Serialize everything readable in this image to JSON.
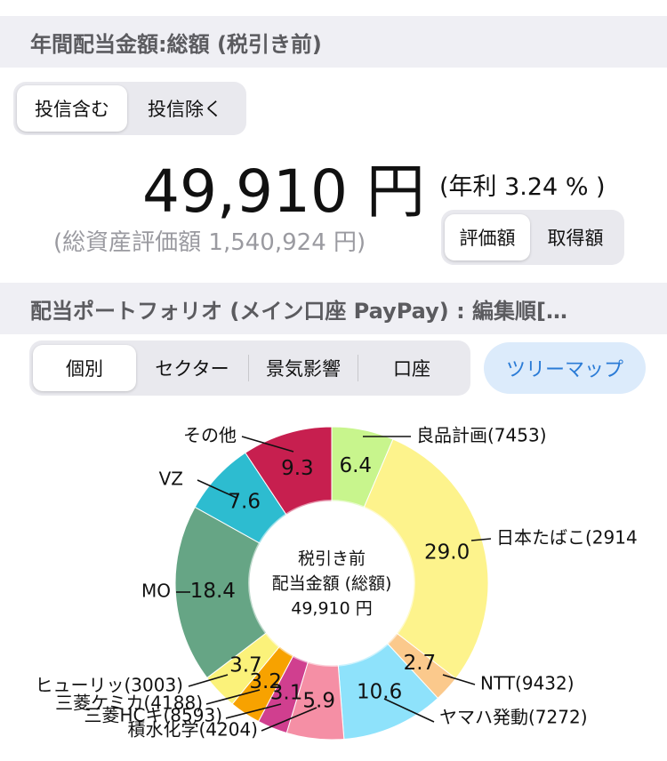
{
  "header1": {
    "title": "年間配当金額:総額 (税引き前)"
  },
  "fund_toggle": {
    "options": [
      "投信含む",
      "投信除く"
    ],
    "selected": 0
  },
  "summary": {
    "amount": "49,910 円",
    "yield": "(年利 3.24 % )",
    "total_assets": "(総資産評価額 1,540,924 円)"
  },
  "value_toggle": {
    "options": [
      "評価額",
      "取得額"
    ],
    "selected": 0
  },
  "header2": {
    "title": "配当ポートフォリオ (メイン口座 PayPay) : 編集順[…"
  },
  "view_tabs": {
    "options": [
      "個別",
      "セクター",
      "景気影響",
      "口座"
    ],
    "selected": 0
  },
  "treemap_button": "ツリーマップ",
  "chart_center": {
    "line1": "税引き前",
    "line2": "配当金額 (総額)",
    "line3": "49,910 円"
  },
  "chart_data": {
    "type": "pie",
    "slices": [
      {
        "name": "良品計画(7453)",
        "value": 6.4,
        "label": "6.4",
        "color": "#c8f58d"
      },
      {
        "name": "日本たばこ(2914",
        "value": 29.0,
        "label": "29.0",
        "color": "#fdf38c"
      },
      {
        "name": "NTT(9432)",
        "value": 2.7,
        "label": "2.7",
        "color": "#fbc98c"
      },
      {
        "name": "ヤマハ発動(7272)",
        "value": 10.6,
        "label": "10.6",
        "color": "#8ee2fb"
      },
      {
        "name": "積水化学(4204)",
        "value": 5.9,
        "label": "5.9",
        "color": "#f58fa5"
      },
      {
        "name": "三菱HCキ(8593)",
        "value": 3.1,
        "label": "3.1",
        "color": "#d03f8f"
      },
      {
        "name": "三菱ケミカ(4188)",
        "value": 3.2,
        "label": "3.2",
        "color": "#f7a200"
      },
      {
        "name": "ヒューリッ(3003)",
        "value": 3.7,
        "label": "3.7",
        "color": "#fbf27a"
      },
      {
        "name": "MO",
        "value": 18.4,
        "label": "18.4",
        "color": "#66a585"
      },
      {
        "name": "VZ",
        "value": 7.6,
        "label": "7.6",
        "color": "#2dbcd0"
      },
      {
        "name": "その他",
        "value": 9.3,
        "label": "9.3",
        "color": "#c71f4f"
      }
    ]
  }
}
